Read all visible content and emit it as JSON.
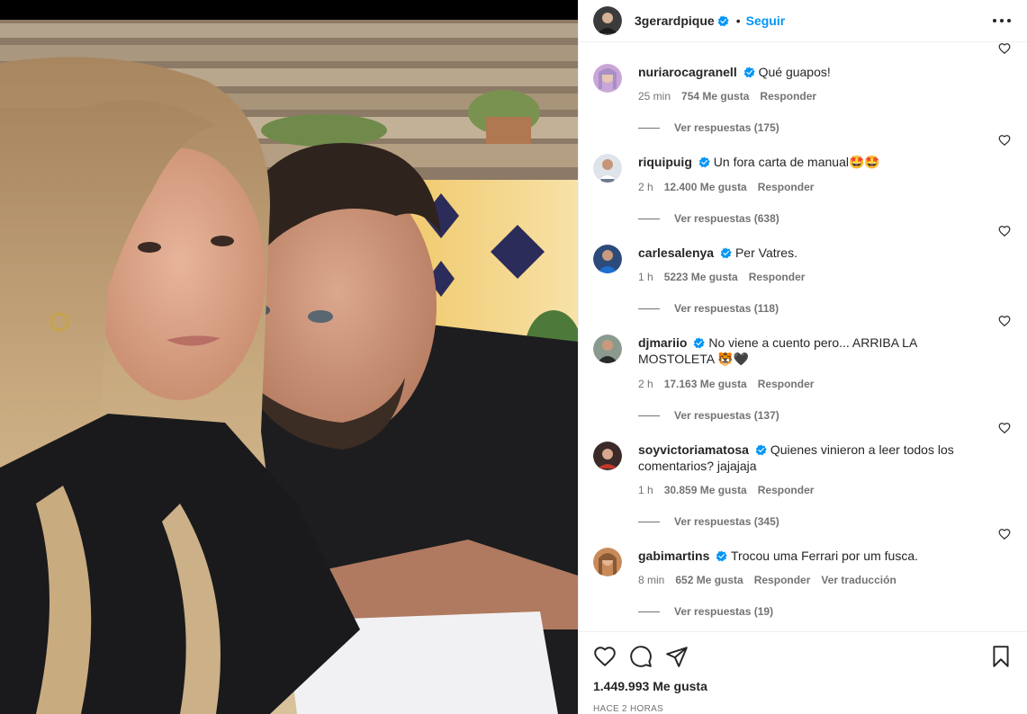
{
  "post": {
    "author": "3gerardpique",
    "follow_label": "Seguir",
    "separator": "•",
    "likes_count": "1.449.993",
    "likes_label": "Me gusta",
    "time_ago": "HACE 2 HORAS"
  },
  "comments": [
    {
      "username": "nuriarocagranell",
      "text": "Qué guapos!",
      "time": "25 min",
      "likes": "754 Me gusta",
      "reply_label": "Responder",
      "translate_label": "",
      "view_replies": "Ver respuestas (175)",
      "avatar_color": "#c9a6d8"
    },
    {
      "username": "riquipuig",
      "text": "Un fora carta de manual",
      "emoji": "🤩🤩",
      "time": "2 h",
      "likes": "12.400 Me gusta",
      "reply_label": "Responder",
      "translate_label": "",
      "view_replies": "Ver respuestas (638)",
      "avatar_color": "#6b7a8c"
    },
    {
      "username": "carlesalenya",
      "text": "Per Vatres.",
      "time": "1 h",
      "likes": "5223 Me gusta",
      "reply_label": "Responder",
      "translate_label": "",
      "view_replies": "Ver respuestas (118)",
      "avatar_color": "#2c4a7a"
    },
    {
      "username": "djmariio",
      "text": "No viene a cuento pero... ARRIBA LA MOSTOLETA",
      "emoji": "🐯🖤",
      "time": "2 h",
      "likes": "17.163 Me gusta",
      "reply_label": "Responder",
      "translate_label": "",
      "view_replies": "Ver respuestas (137)",
      "avatar_color": "#4d5a52"
    },
    {
      "username": "soyvictoriamatosa",
      "text": "Quienes vinieron a leer todos los comentarios? jajajaja",
      "time": "1 h",
      "likes": "30.859 Me gusta",
      "reply_label": "Responder",
      "translate_label": "",
      "view_replies": "Ver respuestas (345)",
      "avatar_color": "#3a2a28"
    },
    {
      "username": "gabimartins",
      "text": "Trocou uma Ferrari por um fusca.",
      "time": "8 min",
      "likes": "652 Me gusta",
      "reply_label": "Responder",
      "translate_label": "Ver traducción",
      "view_replies": "Ver respuestas (19)",
      "avatar_color": "#c98a5a"
    }
  ],
  "colors": {
    "accent": "#0095f6",
    "verified": "#0095f6",
    "muted_text": "#737373",
    "text": "#262626"
  },
  "icons": {
    "more": "more-options-icon",
    "like": "heart-icon",
    "comment": "comment-icon",
    "share": "share-icon",
    "save": "bookmark-icon"
  }
}
